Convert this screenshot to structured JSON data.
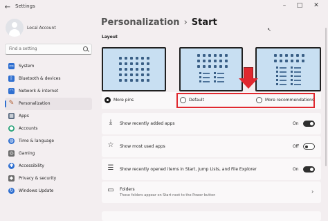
{
  "window": {
    "title": "Settings"
  },
  "account": {
    "name": "Local Account"
  },
  "search": {
    "placeholder": "Find a setting"
  },
  "sidebar": {
    "items": [
      {
        "label": "System",
        "icon": "monitor-icon",
        "color": "#2f6fd0"
      },
      {
        "label": "Bluetooth & devices",
        "icon": "bluetooth-icon",
        "color": "#2f6fd0"
      },
      {
        "label": "Network & internet",
        "icon": "wifi-icon",
        "color": "#2f6fd0"
      },
      {
        "label": "Personalization",
        "icon": "brush-icon",
        "color": "#b05a2c",
        "active": true
      },
      {
        "label": "Apps",
        "icon": "apps-icon",
        "color": "#5a6b80"
      },
      {
        "label": "Accounts",
        "icon": "person-icon",
        "color": "#2aa37a"
      },
      {
        "label": "Time & language",
        "icon": "globe-icon",
        "color": "#2f6fd0"
      },
      {
        "label": "Gaming",
        "icon": "gamepad-icon",
        "color": "#6b6b6b"
      },
      {
        "label": "Accessibility",
        "icon": "accessibility-icon",
        "color": "#2f6fd0"
      },
      {
        "label": "Privacy & security",
        "icon": "shield-icon",
        "color": "#6b6b6b"
      },
      {
        "label": "Windows Update",
        "icon": "update-icon",
        "color": "#2f6fd0"
      }
    ]
  },
  "header": {
    "parent": "Personalization",
    "separator": "›",
    "current": "Start"
  },
  "layout": {
    "label": "Layout",
    "options": [
      "More pins",
      "Default",
      "More recommendations"
    ],
    "selected": "More pins"
  },
  "settings": [
    {
      "label": "Show recently added apps",
      "state": "On",
      "icon": "download-icon"
    },
    {
      "label": "Show most used apps",
      "state": "Off",
      "icon": "star-icon"
    },
    {
      "label": "Show recently opened items in Start, Jump Lists, and File Explorer",
      "state": "On",
      "icon": "list-icon"
    }
  ],
  "folders": {
    "label": "Folders",
    "description": "These folders appear on Start next to the Power button"
  },
  "colors": {
    "accent": "#2f6fd0",
    "highlight": "#e0282f"
  }
}
